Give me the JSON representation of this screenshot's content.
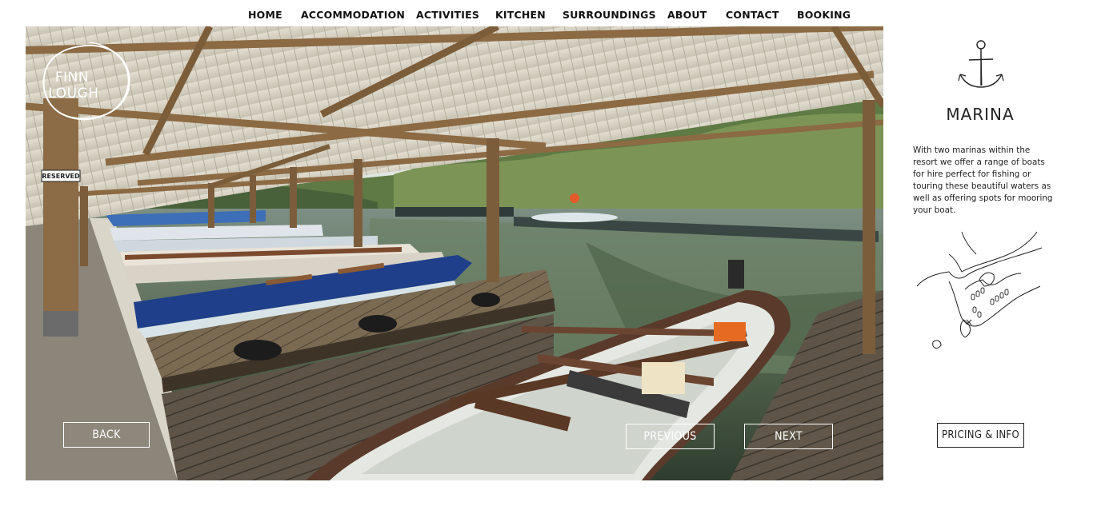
{
  "nav": {
    "items": [
      {
        "label": "HOME"
      },
      {
        "label": "ACCOMMODATION"
      },
      {
        "label": "ACTIVITIES"
      },
      {
        "label": "KITCHEN"
      },
      {
        "label": "SURROUNDINGS"
      },
      {
        "label": "ABOUT"
      },
      {
        "label": "CONTACT"
      },
      {
        "label": "BOOKING"
      }
    ]
  },
  "logo": {
    "line1": "FINN",
    "line2": "LOUGH"
  },
  "hero": {
    "sign_text": "RESERVED",
    "back_label": "BACK",
    "previous_label": "PREVIOUS",
    "next_label": "NEXT"
  },
  "sidebar": {
    "icon": "anchor-icon",
    "title": "MARINA",
    "description": "With two marinas within the resort we offer a range of boats for hire perfect for fishing or touring these beautiful waters as well as offering spots for mooring your boat.",
    "map_icon": "marina-map-illustration",
    "pricing_label": "PRICING & INFO"
  },
  "colors": {
    "nav_text": "#111111",
    "sidebar_text": "#1f1f1f",
    "button_outline_light": "#ffffff",
    "button_outline_dark": "#222222"
  }
}
